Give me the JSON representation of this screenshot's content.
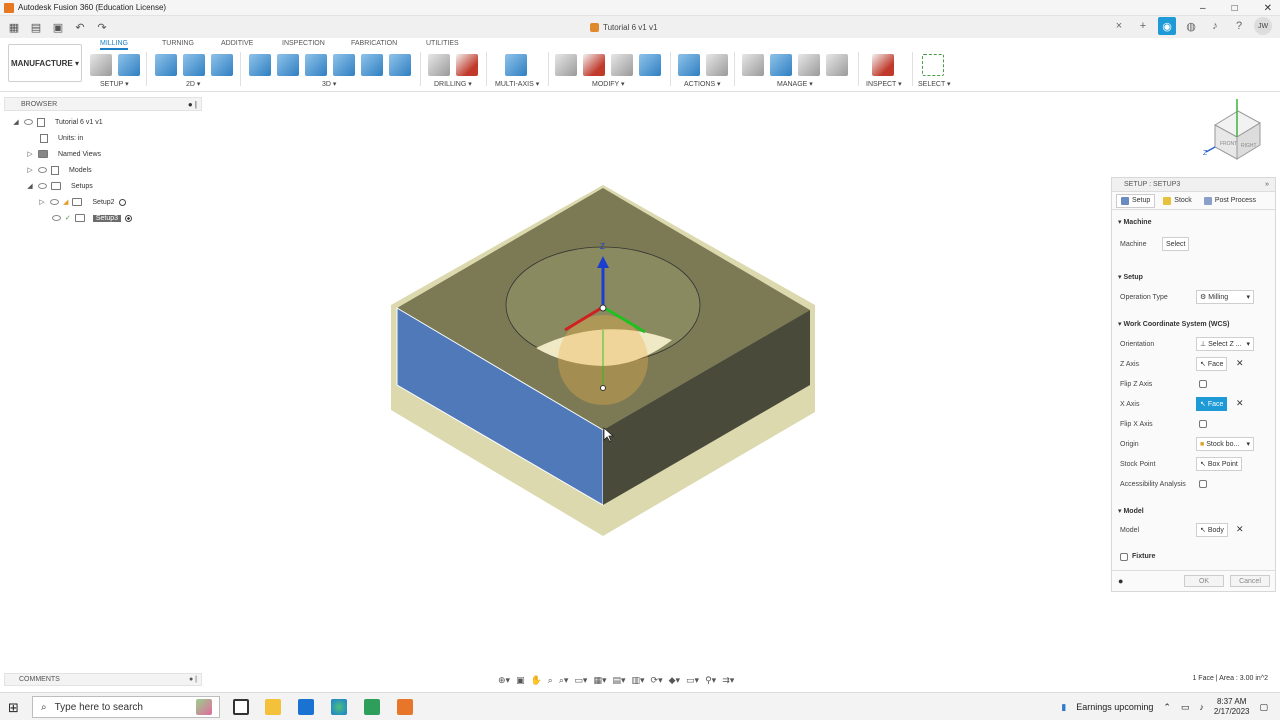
{
  "window": {
    "title": "Autodesk Fusion 360 (Education License)",
    "controls": [
      "–",
      "□",
      "✕"
    ]
  },
  "document_tab": {
    "label": "Tutorial 6 v1 v1",
    "close": "×"
  },
  "qa": {
    "plus": "+",
    "help": "?",
    "user_initials": "JW"
  },
  "workspace": {
    "label": "MANUFACTURE ▾"
  },
  "toolbar_tabs": [
    "MILLING",
    "TURNING",
    "ADDITIVE",
    "INSPECTION",
    "FABRICATION",
    "UTILITIES"
  ],
  "toolbar_groups": [
    "SETUP ▾",
    "2D ▾",
    "3D ▾",
    "DRILLING ▾",
    "MULTI-AXIS ▾",
    "MODIFY ▾",
    "ACTIONS ▾",
    "MANAGE ▾",
    "INSPECT ▾",
    "SELECT ▾"
  ],
  "browser": {
    "title": "BROWSER",
    "items": [
      {
        "label": "Tutorial 6 v1 v1"
      },
      {
        "label": "Units: in"
      },
      {
        "label": "Named Views"
      },
      {
        "label": "Models"
      },
      {
        "label": "Setups"
      },
      {
        "label": "Setup2"
      },
      {
        "label": "Setup3"
      }
    ]
  },
  "panel": {
    "header": "SETUP : SETUP3",
    "tabs": [
      "Setup",
      "Stock",
      "Post Process"
    ],
    "sections": {
      "machine": "Machine",
      "setup": "Setup",
      "wcs": "Work Coordinate System (WCS)",
      "model": "Model",
      "fixture": "Fixture"
    },
    "fields": {
      "machine_label": "Machine",
      "machine_value": "Select",
      "op_type_label": "Operation Type",
      "op_type_value": "Milling",
      "orientation_label": "Orientation",
      "orientation_value": "Select Z ...",
      "z_axis_label": "Z Axis",
      "z_axis_value": "Face",
      "flip_z_label": "Flip Z Axis",
      "x_axis_label": "X Axis",
      "x_axis_value": "Face",
      "flip_x_label": "Flip X Axis",
      "origin_label": "Origin",
      "origin_value": "Stock bo...",
      "stock_point_label": "Stock Point",
      "stock_point_value": "Box Point",
      "accessibility_label": "Accessibility Analysis",
      "model_label": "Model",
      "model_value": "Body"
    },
    "ok": "OK",
    "cancel": "Cancel"
  },
  "comments": {
    "label": "COMMENTS"
  },
  "status": {
    "text": "1 Face | Area : 3.00 in^2"
  },
  "taskbar": {
    "search_placeholder": "Type here to search",
    "weather": "Earnings upcoming",
    "time": "8:37 AM",
    "date": "2/17/2023"
  },
  "colors": {
    "accent": "#1e9ad6",
    "model_top": "#7b7a55",
    "model_front": "#4f79b8",
    "model_side": "#4a4a3a",
    "stock": "#d8d5a6"
  }
}
